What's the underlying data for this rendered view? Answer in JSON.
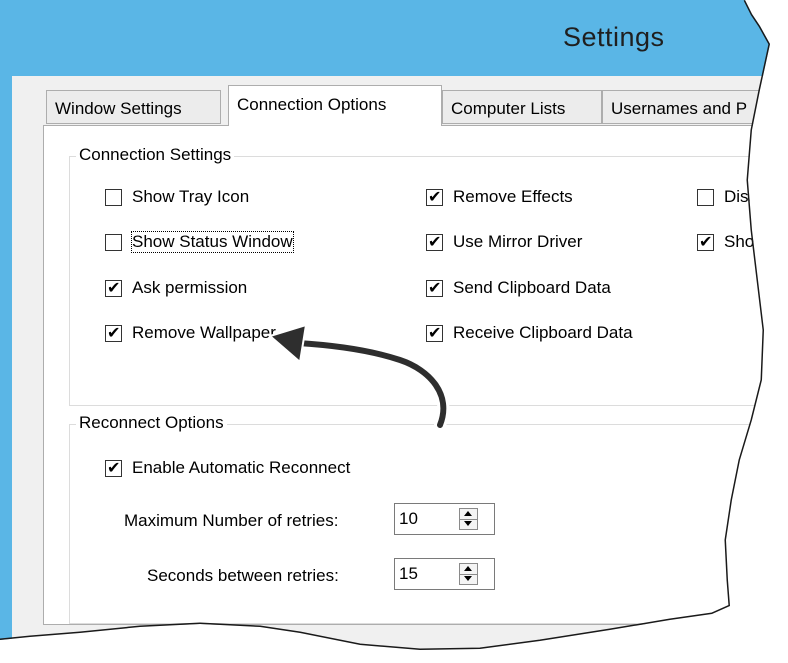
{
  "window": {
    "title": "Settings"
  },
  "tabs": [
    {
      "label": "Window Settings",
      "active": false
    },
    {
      "label": "Connection Options",
      "active": true
    },
    {
      "label": "Computer Lists",
      "active": false
    },
    {
      "label": "Usernames and P",
      "active": false
    }
  ],
  "connection_settings": {
    "group_label": "Connection Settings",
    "checkboxes": [
      {
        "label": "Show Tray Icon",
        "checked": false
      },
      {
        "label": "Show Status Window",
        "checked": false
      },
      {
        "label": "Ask permission",
        "checked": true
      },
      {
        "label": "Remove Wallpaper",
        "checked": true
      },
      {
        "label": "Remove Effects",
        "checked": true
      },
      {
        "label": "Use Mirror Driver",
        "checked": true
      },
      {
        "label": "Send Clipboard Data",
        "checked": true
      },
      {
        "label": "Receive Clipboard Data",
        "checked": true
      },
      {
        "label": "Disab",
        "checked": false
      },
      {
        "label": "Show",
        "checked": true
      }
    ]
  },
  "reconnect_options": {
    "group_label": "Reconnect Options",
    "enable_checkbox": {
      "label": "Enable Automatic Reconnect",
      "checked": true
    },
    "max_retries": {
      "label": "Maximum Number of retries:",
      "value": "10"
    },
    "seconds_between": {
      "label": "Seconds between retries:",
      "value": "15"
    }
  }
}
